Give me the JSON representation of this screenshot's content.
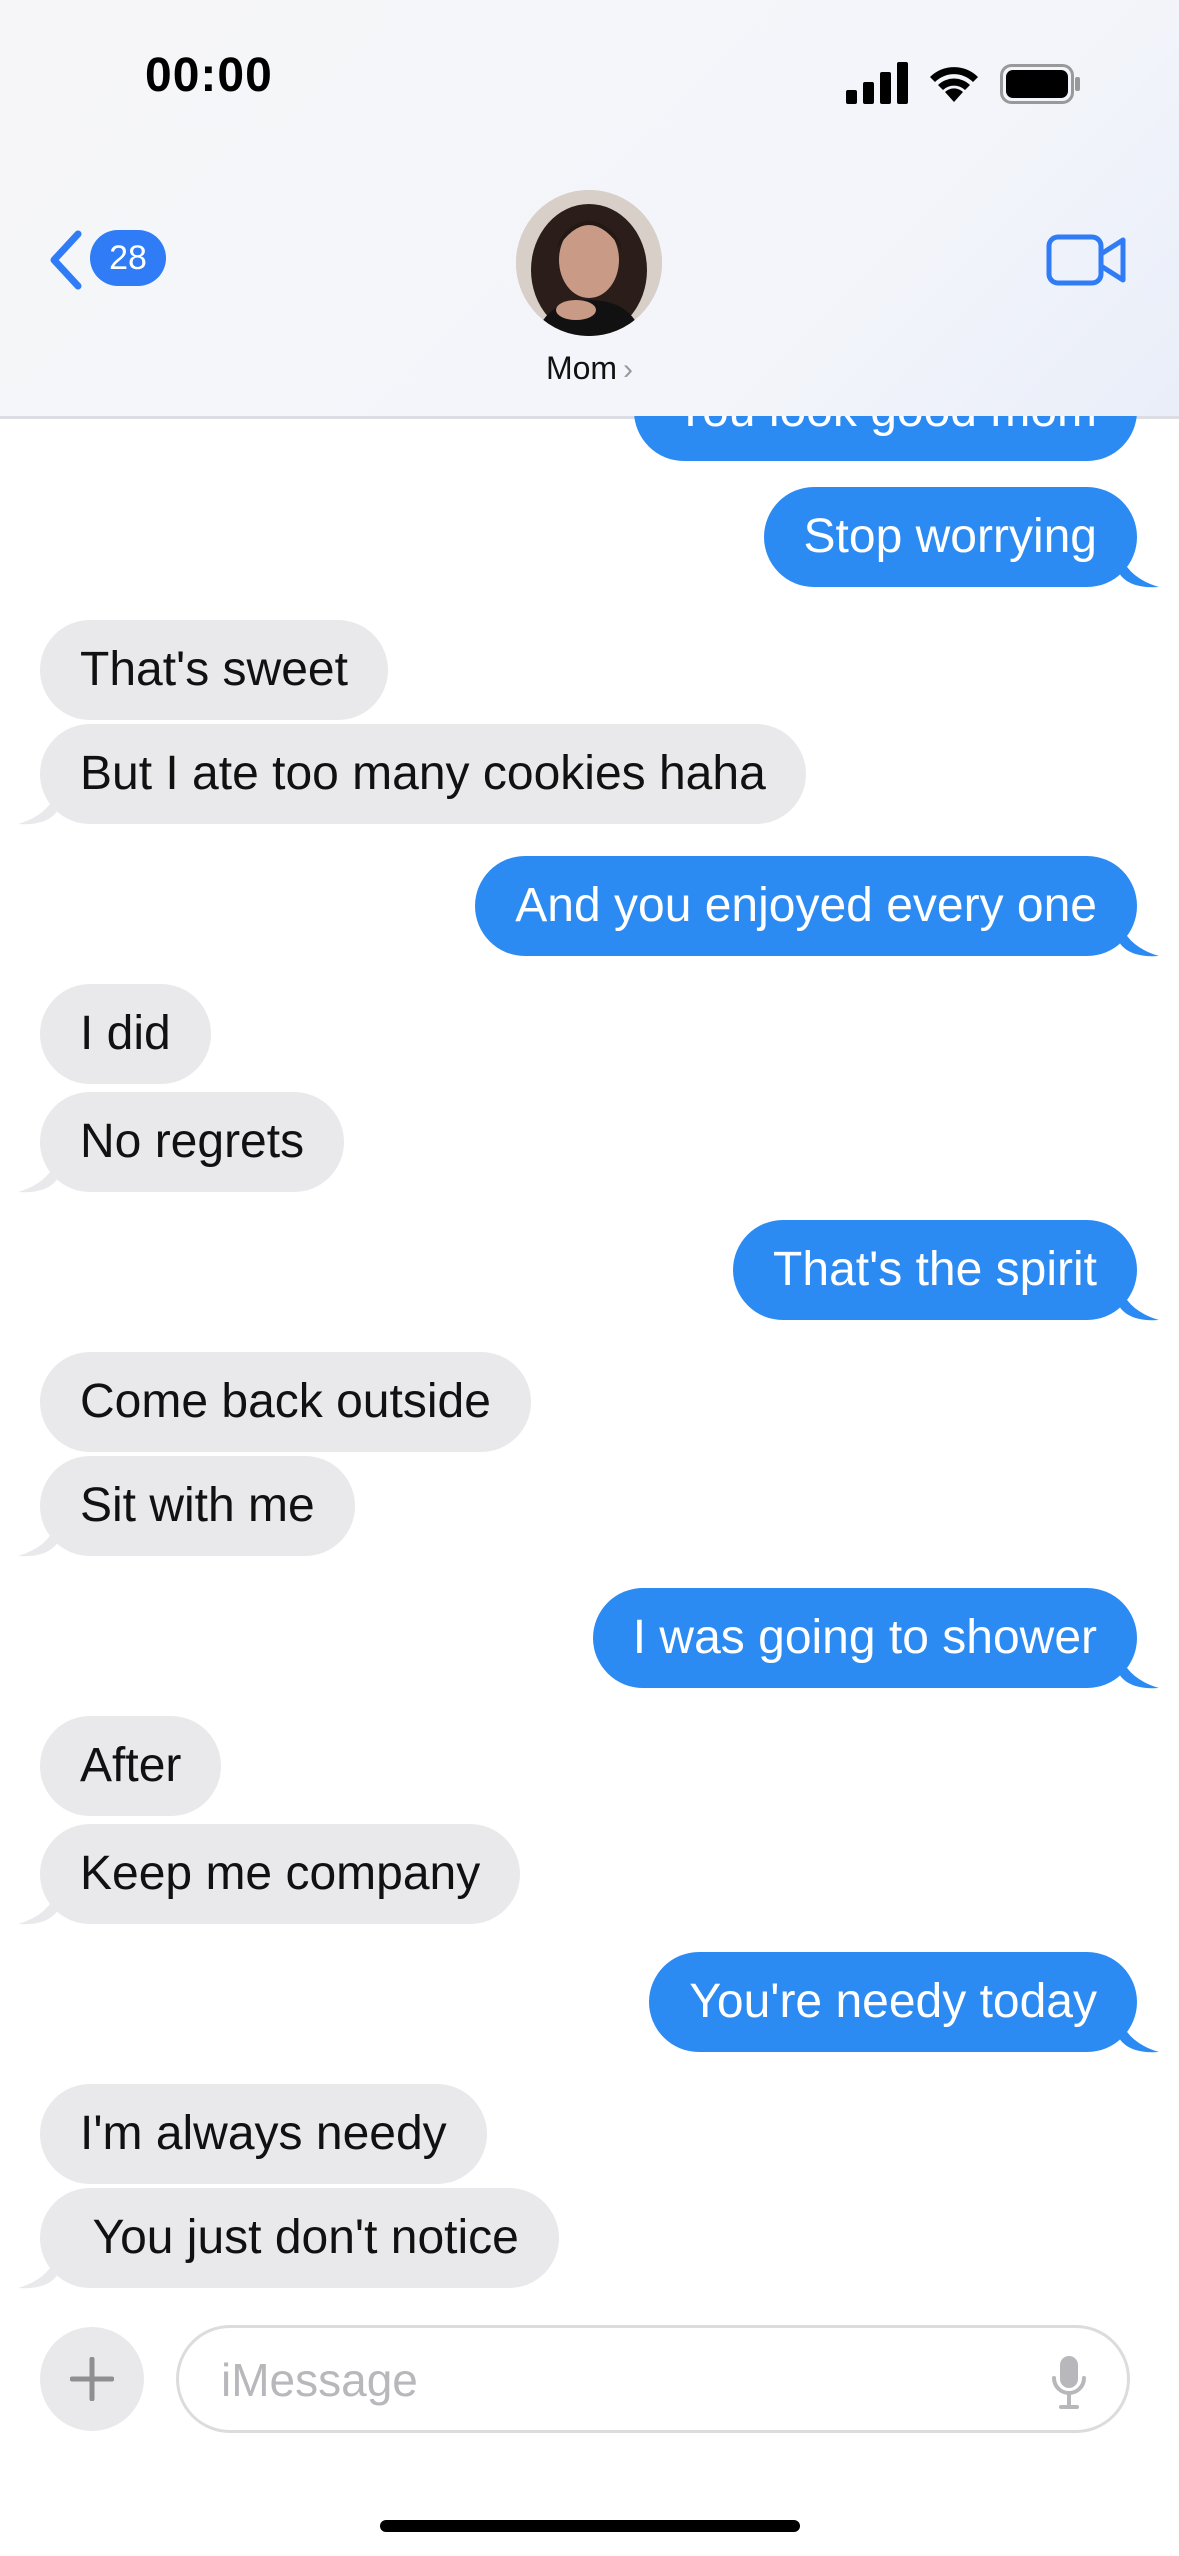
{
  "status_bar": {
    "time": "00:00"
  },
  "header": {
    "unread_count": "28",
    "contact_name": "Mom",
    "icons": {
      "back": "chevron-left-icon",
      "video": "video-camera-icon"
    }
  },
  "colors": {
    "sent_bubble": "#2c8bf3",
    "received_bubble": "#e9e9eb",
    "accent": "#2f7cf6"
  },
  "messages": [
    {
      "dir": "sent",
      "text": "You look good mom"
    },
    {
      "dir": "sent",
      "text": "Stop worrying"
    },
    {
      "dir": "recv",
      "text": "That's sweet"
    },
    {
      "dir": "recv",
      "text": "But I ate too many cookies haha"
    },
    {
      "dir": "sent",
      "text": "And you enjoyed every one"
    },
    {
      "dir": "recv",
      "text": "I did"
    },
    {
      "dir": "recv",
      "text": "No regrets"
    },
    {
      "dir": "sent",
      "text": "That's the spirit"
    },
    {
      "dir": "recv",
      "text": "Come back outside"
    },
    {
      "dir": "recv",
      "text": "Sit with me"
    },
    {
      "dir": "sent",
      "text": "I was going to shower"
    },
    {
      "dir": "recv",
      "text": "After"
    },
    {
      "dir": "recv",
      "text": "Keep me company"
    },
    {
      "dir": "sent",
      "text": "You're needy today"
    },
    {
      "dir": "recv",
      "text": "I'm always needy"
    },
    {
      "dir": "recv",
      "text": " You just don't notice"
    }
  ],
  "composer": {
    "placeholder": "iMessage"
  }
}
